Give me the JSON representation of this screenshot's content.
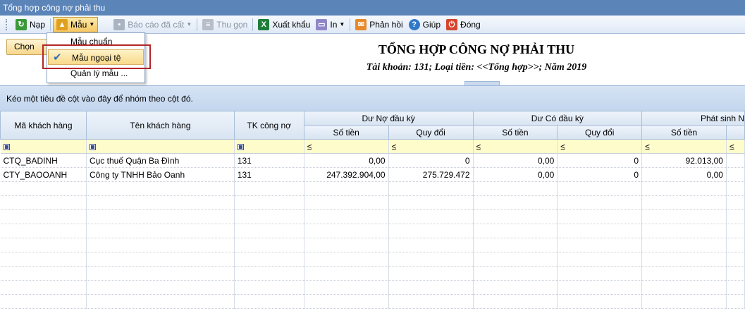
{
  "window": {
    "title": "Tổng hợp công nợ phải thu"
  },
  "toolbar": {
    "nap": "Nạp",
    "mau": "Mẫu",
    "bao_cao_da_cat": "Báo cáo đã cất",
    "thu_gon": "Thu gọn",
    "xuat_khau": "Xuất khẩu",
    "in": "In",
    "phan_hoi": "Phản hồi",
    "giup": "Giúp",
    "dong": "Đóng"
  },
  "chon_button": "Chọn tha",
  "report": {
    "title": "TỔNG HỢP CÔNG NỢ PHẢI THU",
    "subtitle": "Tài khoản: 131; Loại tiền: <<Tổng hợp>>; Năm 2019"
  },
  "group_panel": "Kéo một tiêu đề cột vào đây để nhóm theo cột đó.",
  "menu": {
    "item1": "Mẫu chuẩn",
    "item2": "Mẫu ngoại tệ",
    "item3": "Quản lý mẫu ..."
  },
  "columns": {
    "ma_kh": "Mã khách hàng",
    "ten_kh": "Tên khách hàng",
    "tk": "TK công nợ",
    "du_no": "Dư Nợ đầu kỳ",
    "du_co": "Dư Có đầu kỳ",
    "phat_sinh": "Phát sinh N",
    "so_tien": "Số tiền",
    "quy_doi": "Quy đổi",
    "filter_op": "≤"
  },
  "rows": [
    {
      "ma": "CTQ_BADINH",
      "ten": "Cục thuế Quận Ba Đình",
      "tk": "131",
      "no_st": "0,00",
      "no_qd": "0",
      "co_st": "0,00",
      "co_qd": "0",
      "ps_st": "92.013,00"
    },
    {
      "ma": "CTY_BAOOANH",
      "ten": "Công ty TNHH Bảo Oanh",
      "tk": "131",
      "no_st": "247.392.904,00",
      "no_qd": "275.729.472",
      "co_st": "0,00",
      "co_qd": "0",
      "ps_st": "0,00"
    }
  ],
  "colors": {
    "titlebar": "#5b84b9",
    "highlight_box": "#b5252a"
  }
}
